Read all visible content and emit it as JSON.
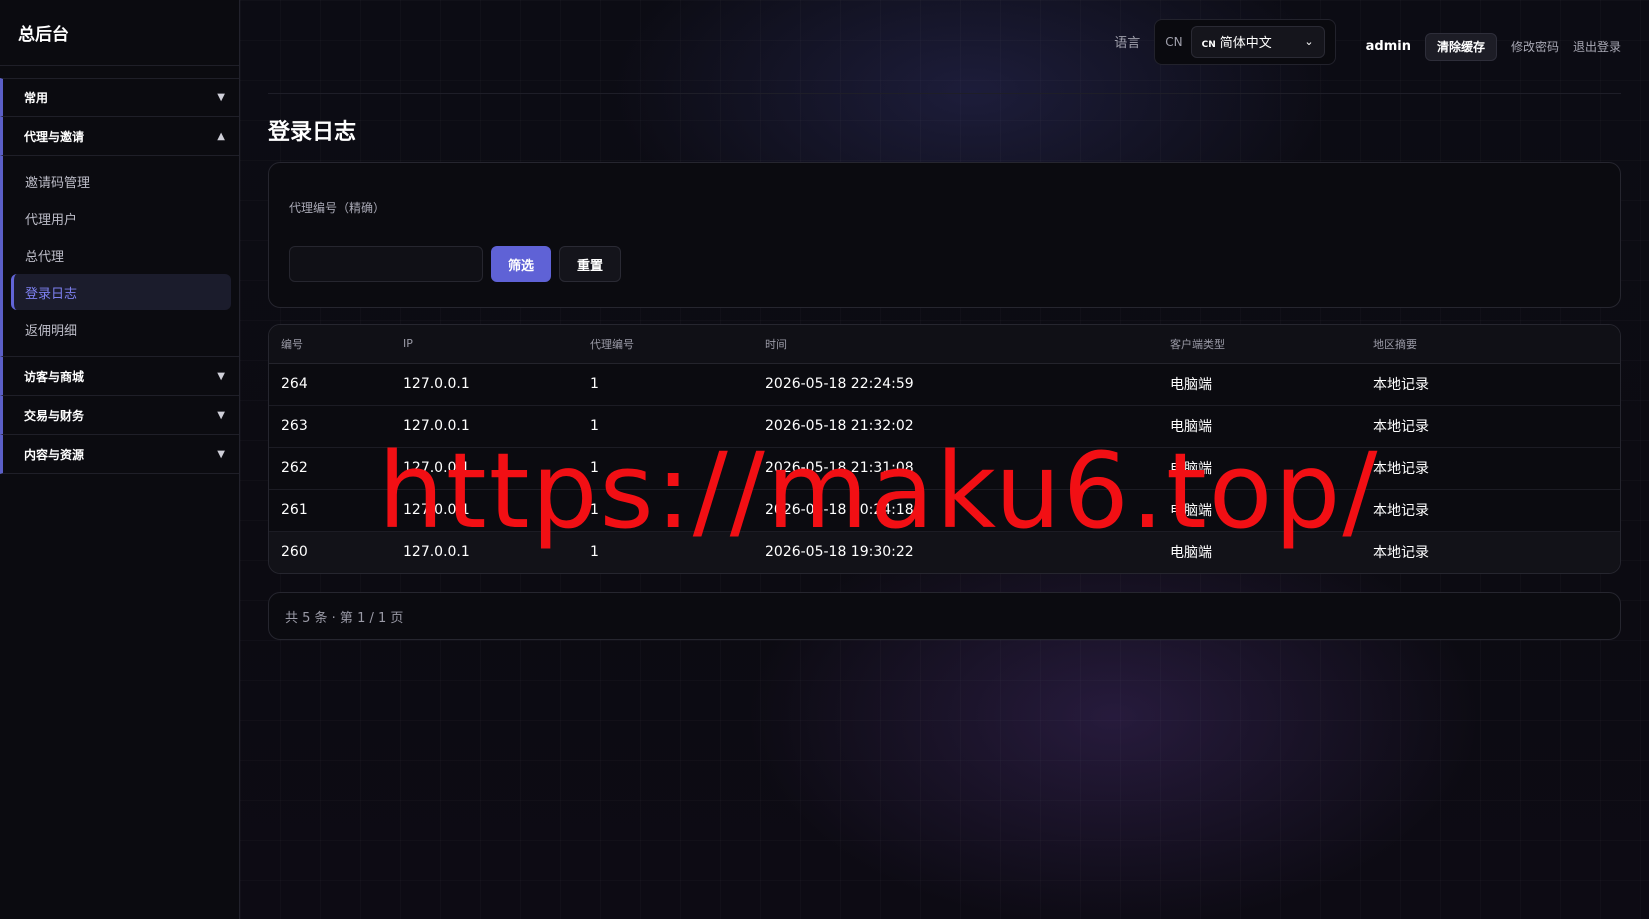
{
  "sidebar": {
    "brand": "总后台",
    "groups": [
      {
        "label": "常用",
        "caret": "▼"
      },
      {
        "label": "代理与邀请",
        "caret": "▲"
      },
      {
        "label": "访客与商城",
        "caret": "▼"
      },
      {
        "label": "交易与财务",
        "caret": "▼"
      },
      {
        "label": "内容与资源",
        "caret": "▼"
      }
    ],
    "sub_items": [
      "邀请码管理",
      "代理用户",
      "总代理",
      "登录日志",
      "返佣明细"
    ]
  },
  "topbar": {
    "lang_label": "语言",
    "lang_code": "CN",
    "lang_flag": "CN",
    "lang_value": "简体中文",
    "user": "admin",
    "clear_cache": "清除缓存",
    "change_password": "修改密码",
    "logout": "退出登录"
  },
  "page": {
    "title": "登录日志"
  },
  "filter": {
    "label": "代理编号（精确）",
    "filter_button": "筛选",
    "reset_button": "重置"
  },
  "table": {
    "headers": [
      "编号",
      "IP",
      "代理编号",
      "时间",
      "客户端类型",
      "地区摘要"
    ],
    "rows": [
      [
        "264",
        "127.0.0.1",
        "1",
        "2026-05-18 22:24:59",
        "电脑端",
        "本地记录"
      ],
      [
        "263",
        "127.0.0.1",
        "1",
        "2026-05-18 21:32:02",
        "电脑端",
        "本地记录"
      ],
      [
        "262",
        "127.0.0.1",
        "1",
        "2026-05-18 21:31:08",
        "电脑端",
        "本地记录"
      ],
      [
        "261",
        "127.0.0.1",
        "1",
        "2026-05-18 20:24:18",
        "电脑端",
        "本地记录"
      ],
      [
        "260",
        "127.0.0.1",
        "1",
        "2026-05-18 19:30:22",
        "电脑端",
        "本地记录"
      ]
    ]
  },
  "pagination": {
    "text": "共 5 条 · 第 1 / 1 页"
  },
  "watermark": "https://maku6.top/",
  "colors": {
    "accent": "#5f62d6",
    "watermark": "#f20f14"
  }
}
